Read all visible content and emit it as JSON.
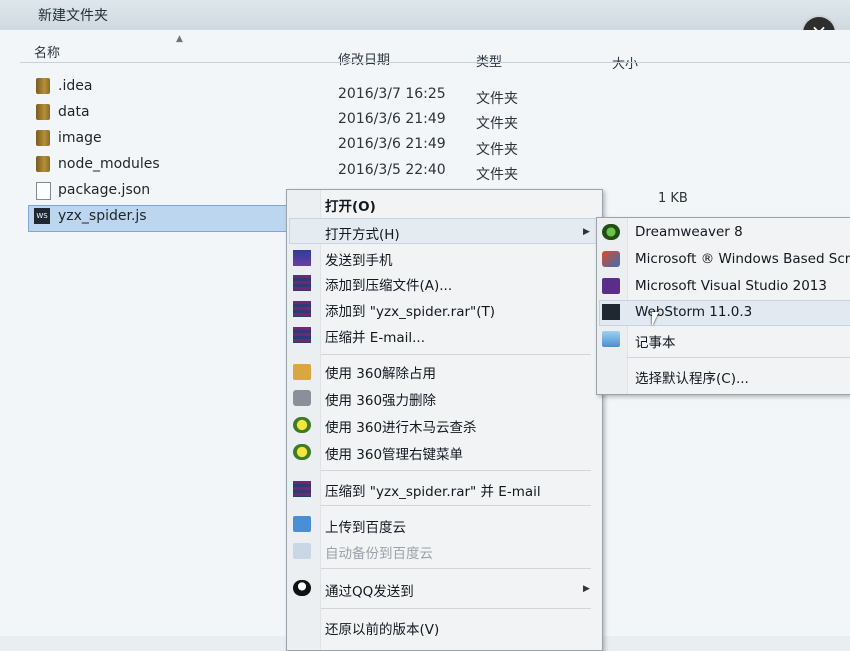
{
  "window": {
    "title": "新建文件夹",
    "close_glyph": "×"
  },
  "columns": {
    "name": "名称",
    "date": "修改日期",
    "type": "类型",
    "size": "大小"
  },
  "files": [
    {
      "name": ".idea",
      "date": "2016/3/7 16:25",
      "type": "文件夹",
      "size": "",
      "icon": "folder-icon"
    },
    {
      "name": "data",
      "date": "2016/3/6 21:49",
      "type": "文件夹",
      "size": "",
      "icon": "folder-icon"
    },
    {
      "name": "image",
      "date": "2016/3/6 21:49",
      "type": "文件夹",
      "size": "",
      "icon": "folder-icon"
    },
    {
      "name": "node_modules",
      "date": "2016/3/5 22:40",
      "type": "文件夹",
      "size": "",
      "icon": "folder-icon"
    },
    {
      "name": "package.json",
      "date": "",
      "type": "",
      "size": "1 KB",
      "icon": "file-icon"
    },
    {
      "name": "yzx_spider.js",
      "date": "",
      "type": "",
      "size": "",
      "icon": "webstorm-file-icon"
    }
  ],
  "context_menu": {
    "items": [
      {
        "label": "打开(O)"
      },
      {
        "label": "打开方式(H)"
      },
      {
        "label": "发送到手机",
        "icon": "send-to-phone-icon"
      },
      {
        "label": "添加到压缩文件(A)...",
        "icon": "winrar-icon"
      },
      {
        "label": "添加到 \"yzx_spider.rar\"(T)",
        "icon": "winrar-icon"
      },
      {
        "label": "压缩并 E-mail...",
        "icon": "winrar-icon"
      },
      {
        "label": "使用 360解除占用",
        "icon": "360-unlock-icon"
      },
      {
        "label": "使用 360强力删除",
        "icon": "360-delete-icon"
      },
      {
        "label": "使用 360进行木马云查杀",
        "icon": "360-scan-icon"
      },
      {
        "label": "使用 360管理右键菜单",
        "icon": "360-menu-icon"
      },
      {
        "label": "压缩到 \"yzx_spider.rar\" 并 E-mail",
        "icon": "winrar-icon"
      },
      {
        "label": "上传到百度云",
        "icon": "baidu-cloud-icon"
      },
      {
        "label": "自动备份到百度云",
        "icon": "baidu-cloud-icon"
      },
      {
        "label": "通过QQ发送到",
        "icon": "qq-penguin-icon"
      },
      {
        "label": "还原以前的版本(V)"
      }
    ]
  },
  "open_with_menu": {
    "items": [
      {
        "label": "Dreamweaver 8",
        "icon": "dreamweaver-icon"
      },
      {
        "label": "Microsoft ® Windows Based Scr",
        "icon": "script-host-icon"
      },
      {
        "label": "Microsoft Visual Studio 2013",
        "icon": "visual-studio-icon"
      },
      {
        "label": "WebStorm 11.0.3",
        "icon": "webstorm-icon"
      },
      {
        "label": "记事本",
        "icon": "notepad-icon"
      },
      {
        "label": "选择默认程序(C)..."
      }
    ]
  },
  "glyphs": {
    "submenu_arrow": "▶",
    "sort_caret": "▲"
  }
}
